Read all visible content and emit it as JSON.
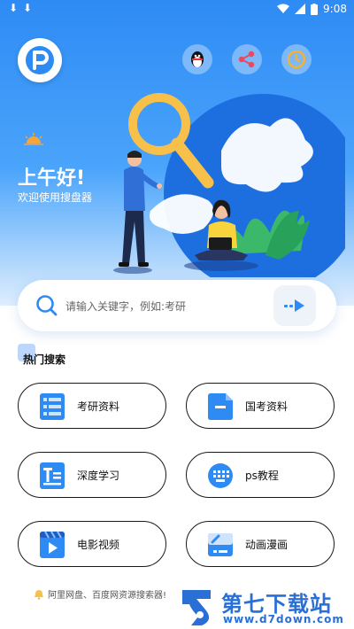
{
  "status_bar": {
    "time": "9:08"
  },
  "header": {
    "greeting": "上午好!",
    "welcome": "欢迎使用搜盘器"
  },
  "search": {
    "placeholder": "请输入关键字，例如:考研"
  },
  "hot_section": {
    "title": "热门搜索"
  },
  "categories": [
    {
      "label": "考研资料",
      "icon": "list-doc-icon"
    },
    {
      "label": "国考资料",
      "icon": "file-doc-icon"
    },
    {
      "label": "深度学习",
      "icon": "text-doc-icon"
    },
    {
      "label": "ps教程",
      "icon": "keyboard-icon"
    },
    {
      "label": "电影视频",
      "icon": "video-icon"
    },
    {
      "label": "动画漫画",
      "icon": "comic-icon"
    }
  ],
  "footer": {
    "note": "阿里网盘、百度网资源搜索器!"
  },
  "watermark": {
    "brand": "第七下载站",
    "url": "www.d7down.com"
  },
  "colors": {
    "primary": "#2e8bf4",
    "accent_yellow": "#f8c84c",
    "card_border": "#1a1a1a"
  }
}
